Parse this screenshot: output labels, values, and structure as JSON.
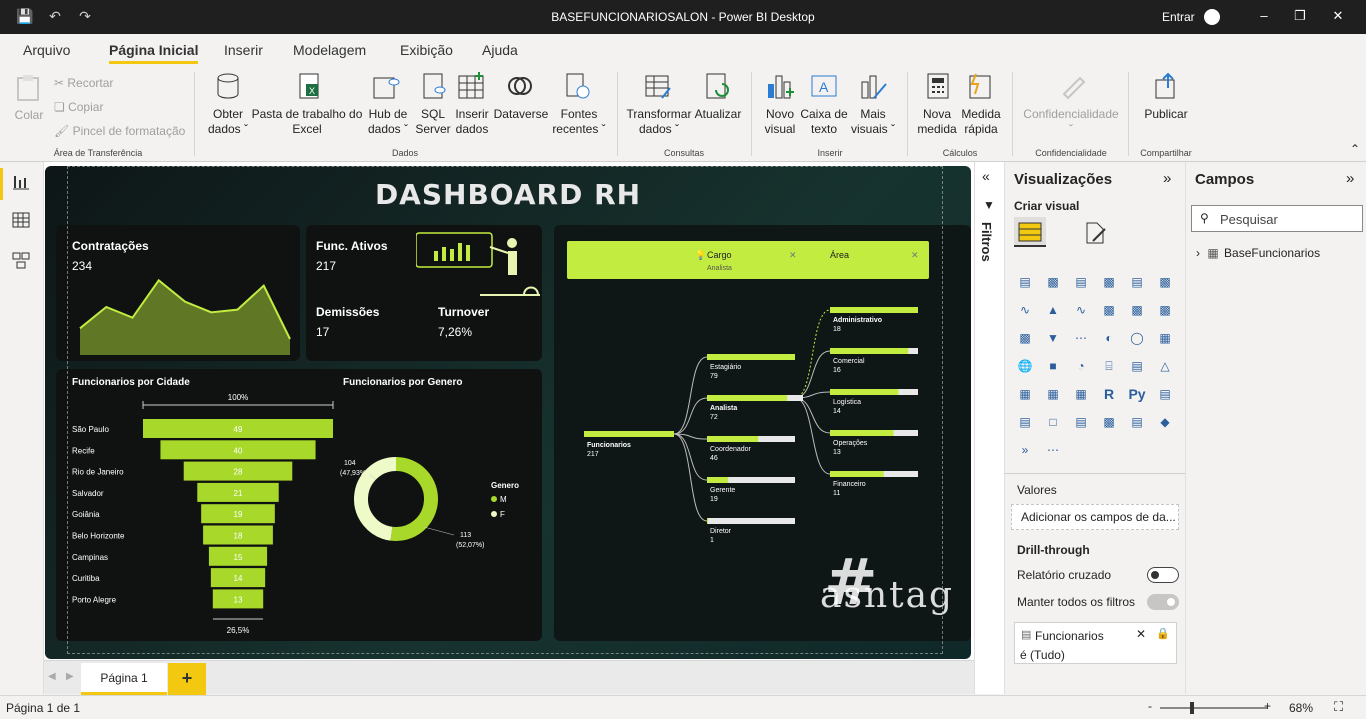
{
  "window": {
    "title": "BASEFUNCIONARIOSALON - Power BI Desktop",
    "signin": "Entrar"
  },
  "menu": {
    "tabs": [
      "Arquivo",
      "Página Inicial",
      "Inserir",
      "Modelagem",
      "Exibição",
      "Ajuda"
    ],
    "active": "Página Inicial"
  },
  "ribbon": {
    "colar": "Colar",
    "recortar": "Recortar",
    "copiar": "Copiar",
    "pincel": "Pincel de formatação",
    "grp_transfer": "Área de Transferência",
    "obter1": "Obter",
    "obter2": "dados",
    "pasta1": "Pasta de trabalho do",
    "pasta2": "Excel",
    "hub1": "Hub de",
    "hub2": "dados",
    "sql1": "SQL",
    "sql2": "Server",
    "ins1": "Inserir",
    "ins2": "dados",
    "dataverse": "Dataverse",
    "fontes1": "Fontes",
    "fontes2": "recentes",
    "grp_dados": "Dados",
    "transf1": "Transformar",
    "transf2": "dados",
    "atualizar": "Atualizar",
    "grp_consultas": "Consultas",
    "novo1": "Novo",
    "novo2": "visual",
    "caixa1": "Caixa de",
    "caixa2": "texto",
    "mais1": "Mais",
    "mais2": "visuais",
    "grp_inserir": "Inserir",
    "nova1": "Nova",
    "nova2": "medida",
    "medida1": "Medida",
    "medida2": "rápida",
    "grp_calc": "Cálculos",
    "conf": "Confidencialidade",
    "grp_conf": "Confidencialidade",
    "publicar": "Publicar",
    "grp_comp": "Compartilhar"
  },
  "dashboard": {
    "title": "DASHBOARD RH",
    "contratacoes_label": "Contratações",
    "contratacoes_value": "234",
    "ativos_label": "Func. Ativos",
    "ativos_value": "217",
    "demissoes_label": "Demissões",
    "demissoes_value": "17",
    "turnover_label": "Turnover",
    "turnover_value": "7,26%",
    "cidade_title": "Funcionarios por Cidade",
    "cidade_top": "100%",
    "cidade_bottom": "26,5%",
    "genero_title": "Funcionarios por Genero",
    "genero_legend_title": "Genero",
    "genero_f_label": "104",
    "genero_f_pct": "(47,93%)",
    "genero_m_label": "113",
    "genero_m_pct": "(52,07%)",
    "legend_m": "M",
    "legend_f": "F",
    "tree_cargo": "Cargo",
    "tree_cargo_sub": "Analista",
    "tree_area": "Área",
    "root_label": "Funcionarios",
    "root_value": "217",
    "logo_text": "asntag"
  },
  "chart_data": [
    {
      "type": "area",
      "title": "Contratações",
      "values": [
        10,
        18,
        14,
        28,
        20,
        16,
        17,
        26,
        6
      ]
    },
    {
      "type": "bar",
      "title": "Funcionarios por Cidade",
      "categories": [
        "São Paulo",
        "Recife",
        "Rio de Janeiro",
        "Salvador",
        "Goiânia",
        "Belo Horizonte",
        "Campinas",
        "Curitiba",
        "Porto Alegre"
      ],
      "values": [
        49,
        40,
        28,
        21,
        19,
        18,
        15,
        14,
        13
      ]
    },
    {
      "type": "pie",
      "title": "Funcionarios por Genero",
      "categories": [
        "M",
        "F"
      ],
      "values": [
        113,
        104
      ]
    },
    {
      "type": "bar",
      "title": "Cargo",
      "categories": [
        "Estagiário",
        "Analista",
        "Coordenador",
        "Gerente",
        "Diretor"
      ],
      "values": [
        79,
        72,
        46,
        19,
        1
      ]
    },
    {
      "type": "bar",
      "title": "Área",
      "categories": [
        "Administrativo",
        "Comercial",
        "Logística",
        "Operações",
        "Financeiro"
      ],
      "values": [
        18,
        16,
        14,
        13,
        11
      ]
    }
  ],
  "pages": {
    "tab": "Página 1"
  },
  "filters": {
    "label": "Filtros"
  },
  "viz": {
    "title": "Visualizações",
    "criar": "Criar visual",
    "valores": "Valores",
    "valores_placeholder": "Adicionar os campos de da...",
    "drill": "Drill-through",
    "rel_cruzado": "Relatório cruzado",
    "manter": "Manter todos os filtros",
    "filter_field": "Funcionarios",
    "filter_value": "é (Tudo)"
  },
  "fields": {
    "title": "Campos",
    "search": "Pesquisar",
    "table": "BaseFuncionarios"
  },
  "status": {
    "page": "Página 1 de 1",
    "zoom": "68%"
  },
  "colors": {
    "accent": "#c2ec3f",
    "yellow": "#f2c811"
  }
}
